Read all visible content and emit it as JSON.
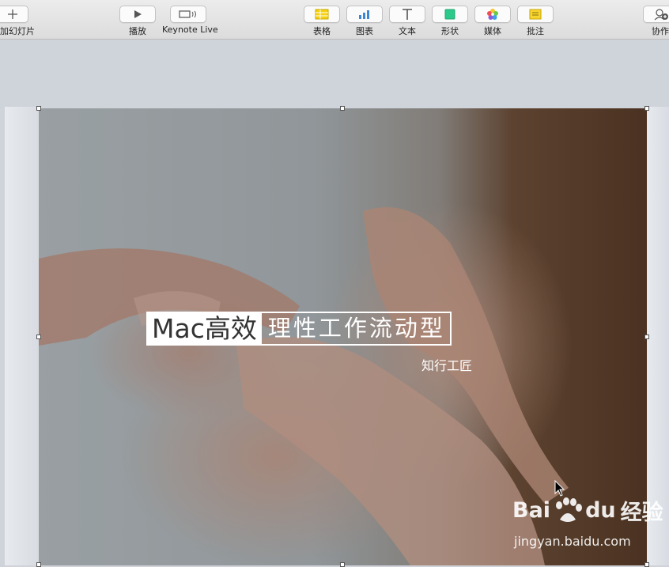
{
  "toolbar": {
    "items": [
      {
        "label": "加幻灯片",
        "icon": "plus-icon"
      },
      {
        "label": "播放",
        "icon": "play-icon"
      },
      {
        "label": "Keynote Live",
        "icon": "keynote-live-icon"
      },
      {
        "label": "表格",
        "icon": "table-icon"
      },
      {
        "label": "图表",
        "icon": "chart-icon"
      },
      {
        "label": "文本",
        "icon": "text-icon"
      },
      {
        "label": "形状",
        "icon": "shape-icon"
      },
      {
        "label": "媒体",
        "icon": "media-icon"
      },
      {
        "label": "批注",
        "icon": "comment-icon"
      },
      {
        "label": "协作",
        "icon": "collaborate-icon"
      }
    ]
  },
  "slide": {
    "title_left": "Mac高效",
    "title_right": "理性工作流动型",
    "subtitle": "知行工匠"
  },
  "watermark": {
    "brand_left": "Bai",
    "brand_right": "du",
    "brand_cn": "经验",
    "url": "jingyan.baidu.com"
  },
  "colors": {
    "table": "#f5d10f",
    "chart": "#3f86d6",
    "shape": "#2bc98a",
    "comment": "#f6d533"
  }
}
